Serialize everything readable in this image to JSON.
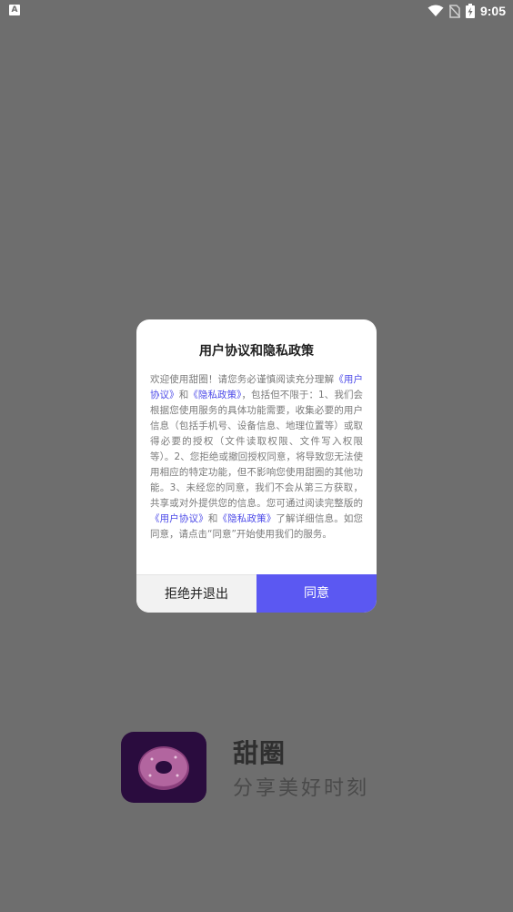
{
  "statusbar": {
    "time": "9:05",
    "left_icon": "A",
    "icons": [
      "wifi-icon",
      "no-sim-icon",
      "battery-charging-icon"
    ]
  },
  "splash": {
    "app_name": "甜圈",
    "slogan": "分享美好时刻"
  },
  "dialog": {
    "title": "用户协议和隐私政策",
    "body": [
      {
        "t": "text",
        "v": "欢迎使用甜圈！请您务必谨慎阅读充分理解"
      },
      {
        "t": "link",
        "v": "《用户协议》"
      },
      {
        "t": "text",
        "v": "和"
      },
      {
        "t": "link",
        "v": "《隐私政策》"
      },
      {
        "t": "text",
        "v": "，包括但不限于：1、我们会根据您使用服务的具体功能需要，收集必要的用户信息（包括手机号、设备信息、地理位置等）或取得必要的授权（文件读取权限、文件写入权限等）。2、您拒绝或撤回授权同意，将导致您无法使用相应的特定功能，但不影响您使用甜圈的其他功能。3、未经您的同意，我们不会从第三方获取，共享或对外提供您的信息。您可通过阅读完整版的"
      },
      {
        "t": "link",
        "v": "《用户协议》"
      },
      {
        "t": "text",
        "v": "和"
      },
      {
        "t": "link",
        "v": "《隐私政策》"
      },
      {
        "t": "text",
        "v": "了解详细信息。如您同意，请点击“同意”开始使用我们的服务。"
      }
    ],
    "reject_label": "拒绝并退出",
    "agree_label": "同意"
  },
  "colors": {
    "overlay": "#6e6e6e",
    "accent": "#5b58f2",
    "link": "#4c4ae8"
  }
}
